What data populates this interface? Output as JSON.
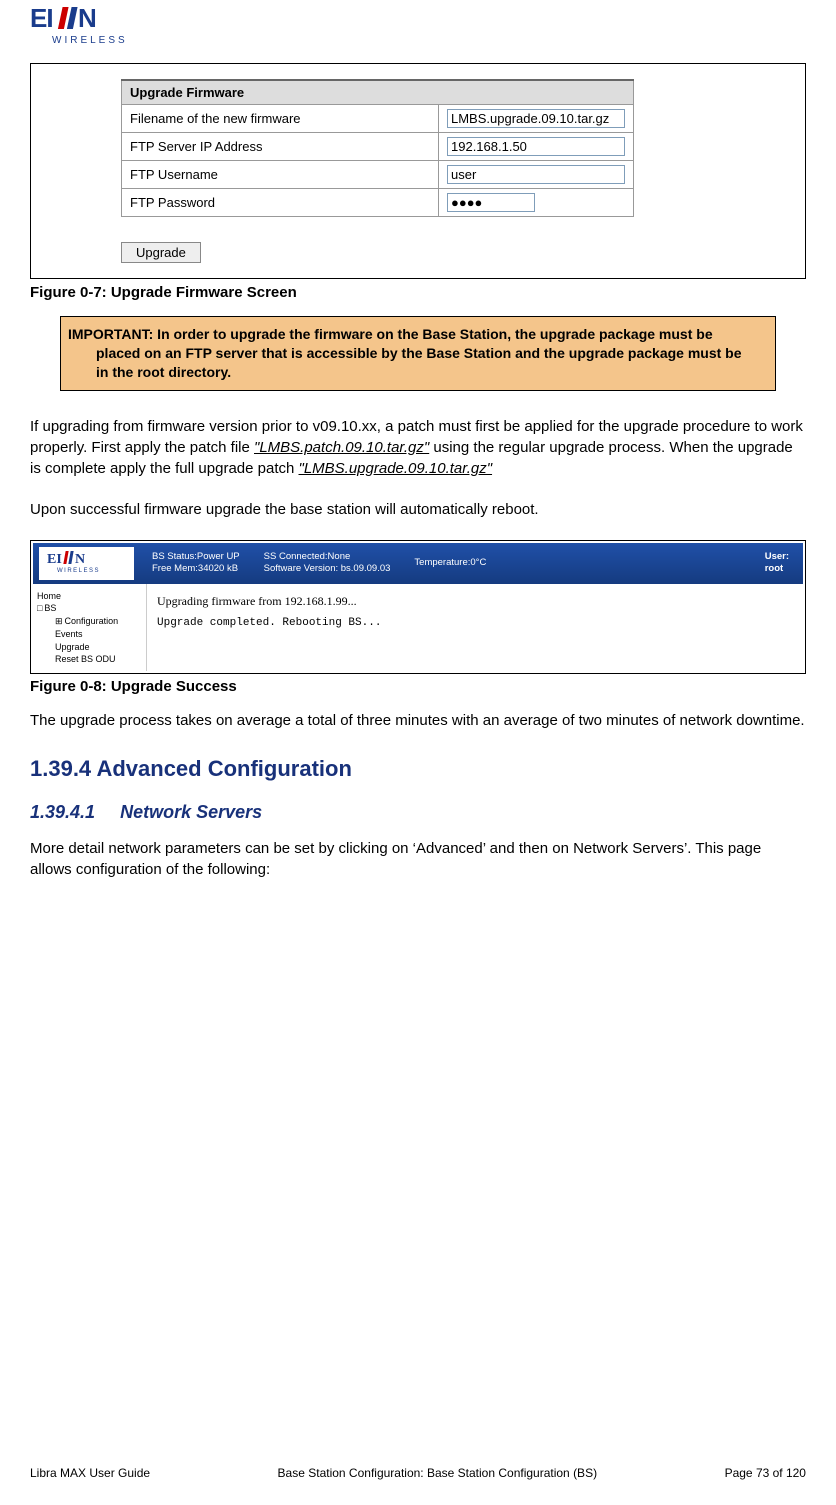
{
  "logo": {
    "brand": "EION",
    "subbrand": "WIRELESS"
  },
  "upgrade_form": {
    "header": "Upgrade Firmware",
    "rows": [
      {
        "label": "Filename of the new firmware",
        "value": "LMBS.upgrade.09.10.tar.gz"
      },
      {
        "label": "FTP Server IP Address",
        "value": "192.168.1.50"
      },
      {
        "label": "FTP Username",
        "value": "user"
      },
      {
        "label": "FTP Password",
        "value": "●●●●"
      }
    ],
    "button": "Upgrade"
  },
  "figure7_caption": "Figure 0-7: Upgrade Firmware Screen",
  "important_text": "IMPORTANT: In order to upgrade the firmware on the Base Station, the upgrade package must be placed on an FTP server that is accessible by the Base Station and the upgrade package must be in the root directory.",
  "para1_a": "If upgrading from firmware version prior to v09.10.xx, a patch must first be applied for the upgrade procedure to work properly. First apply the patch file ",
  "para1_file1": "\"LMBS.patch.09.10.tar.gz\"",
  "para1_b": " using the regular upgrade process. When the upgrade is complete apply the full upgrade patch ",
  "para1_file2": "\"LMBS.upgrade.09.10.tar.gz\"",
  "para2": "Upon successful firmware upgrade the base station will automatically reboot.",
  "success_screen": {
    "status": {
      "col1a": "BS Status:Power UP",
      "col1b": "Free Mem:34020 kB",
      "col2a": "SS Connected:None",
      "col2b": "Software Version: bs.09.09.03",
      "col3a": "Temperature:0°C",
      "user_label": "User:",
      "user_value": "root"
    },
    "nav": {
      "home": "Home",
      "bs": "BS",
      "config": "Configuration",
      "events": "Events",
      "upgrade": "Upgrade",
      "reset": "Reset BS ODU"
    },
    "msg1": "Upgrading firmware from 192.168.1.99...",
    "msg2": "Upgrade completed. Rebooting BS..."
  },
  "figure8_caption": "Figure 0-8: Upgrade Success",
  "para3": "The upgrade process takes on average a total of three minutes with an average of two minutes of network downtime.",
  "h1": "1.39.4 Advanced Configuration",
  "h2_num": "1.39.4.1",
  "h2_title": "Network Servers",
  "para4": "More detail network parameters can be set by clicking on ‘Advanced’ and then on Network Servers’. This page allows configuration of the following:",
  "footer": {
    "left": "Libra MAX User Guide",
    "center": "Base Station Configuration: Base Station Configuration (BS)",
    "right": "Page 73 of 120"
  }
}
